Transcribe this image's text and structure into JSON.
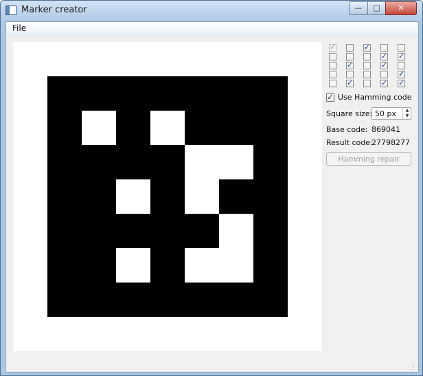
{
  "window": {
    "title": "Marker creator",
    "minimize": "—",
    "maximize": "□",
    "close": "✕"
  },
  "menu": {
    "file_label": "File"
  },
  "marker": {
    "grid": [
      [
        1,
        1,
        1,
        1,
        1,
        1,
        1
      ],
      [
        1,
        0,
        1,
        0,
        1,
        1,
        1
      ],
      [
        1,
        1,
        1,
        1,
        0,
        0,
        1
      ],
      [
        1,
        1,
        0,
        1,
        0,
        1,
        1
      ],
      [
        1,
        1,
        1,
        1,
        1,
        0,
        1
      ],
      [
        1,
        1,
        0,
        1,
        0,
        0,
        1
      ],
      [
        1,
        1,
        1,
        1,
        1,
        1,
        1
      ]
    ]
  },
  "bits": [
    [
      1,
      0,
      1,
      0,
      0
    ],
    [
      0,
      0,
      0,
      1,
      1
    ],
    [
      0,
      1,
      0,
      1,
      0
    ],
    [
      0,
      0,
      0,
      0,
      1
    ],
    [
      0,
      1,
      0,
      1,
      1
    ]
  ],
  "hamming": {
    "label": "Use Hamming code",
    "checked": true
  },
  "square_size": {
    "label": "Square size:",
    "value": "50 px"
  },
  "base_code": {
    "label": "Base code:",
    "value": "869041"
  },
  "result_code": {
    "label": "Result code:",
    "value": "27798277"
  },
  "repair_button": {
    "label": "Hamming repair",
    "enabled": false
  }
}
